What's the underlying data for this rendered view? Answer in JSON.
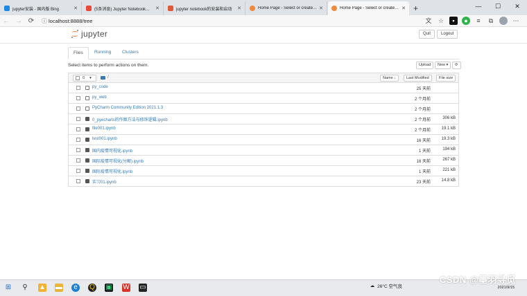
{
  "browser": {
    "tabs": [
      {
        "title": "jupyter安装 - 国内版 Bing",
        "favicon_color": "#1e88e5"
      },
      {
        "title": "(5条消息) Jupyter Notebook安装",
        "favicon_color": "#e84a3a"
      },
      {
        "title": "jupyter notebook的安装和启动",
        "favicon_color": "#e05a3a"
      },
      {
        "title": "Home Page - Select or create a n",
        "favicon_color": "#f08a3a"
      },
      {
        "title": "Home Page - Select or create a n",
        "favicon_color": "#f08a3a"
      }
    ],
    "active_tab_index": 4,
    "url": "localhost:8888/tree",
    "window_controls": {
      "minimize": "—",
      "maximize": "☐",
      "close": "✕"
    }
  },
  "header": {
    "logo_text": "jupyter",
    "quit_label": "Quit",
    "logout_label": "Logout"
  },
  "page_tabs": {
    "files": "Files",
    "running": "Running",
    "clusters": "Clusters"
  },
  "actions": {
    "select_message": "Select items to perform actions on them.",
    "upload_label": "Upload",
    "new_label": "New ▾",
    "refresh_label": "⟳"
  },
  "list_header": {
    "selected_count": "0",
    "breadcrumb_root": "/",
    "name_label": "Name ↓",
    "last_modified_label": "Last Modified",
    "file_size_label": "File size"
  },
  "files": [
    {
      "name": "py_code",
      "type": "folder",
      "modified": "25 天前",
      "size": ""
    },
    {
      "name": "py_web",
      "type": "folder",
      "modified": "2 个月前",
      "size": ""
    },
    {
      "name": "PyCharm Community Edition 2021.1.3",
      "type": "folder",
      "modified": "2 个月前",
      "size": ""
    },
    {
      "name": "0_pyecharts的作图方法与修饰逻辑.ipynb",
      "type": "notebook",
      "modified": "2 个月前",
      "size": "306 kB"
    },
    {
      "name": "file001.ipynb",
      "type": "notebook",
      "modified": "2 个月前",
      "size": "19.1 kB"
    },
    {
      "name": "test001.ipynb",
      "type": "notebook",
      "modified": "16 天前",
      "size": "19.3 kB"
    },
    {
      "name": "国内疫情可视化.ipynb",
      "type": "notebook",
      "modified": "1 天前",
      "size": "194 kB"
    },
    {
      "name": "国际疫情可视化(分解).ipynb",
      "type": "notebook",
      "modified": "16 天前",
      "size": "267 kB"
    },
    {
      "name": "国际疫情可视化.ipynb",
      "type": "notebook",
      "modified": "1 天前",
      "size": "221 kB"
    },
    {
      "name": "实习01.ipynb",
      "type": "notebook",
      "modified": "23 天前",
      "size": "14.8 kB"
    }
  ],
  "taskbar": {
    "weather": "26°C 空气良",
    "date": "2021/9/15",
    "watermark": "CSDN @墨羽寻觅"
  },
  "colors": {
    "link": "#337ab7",
    "jupyter_orange": "#f37726"
  }
}
